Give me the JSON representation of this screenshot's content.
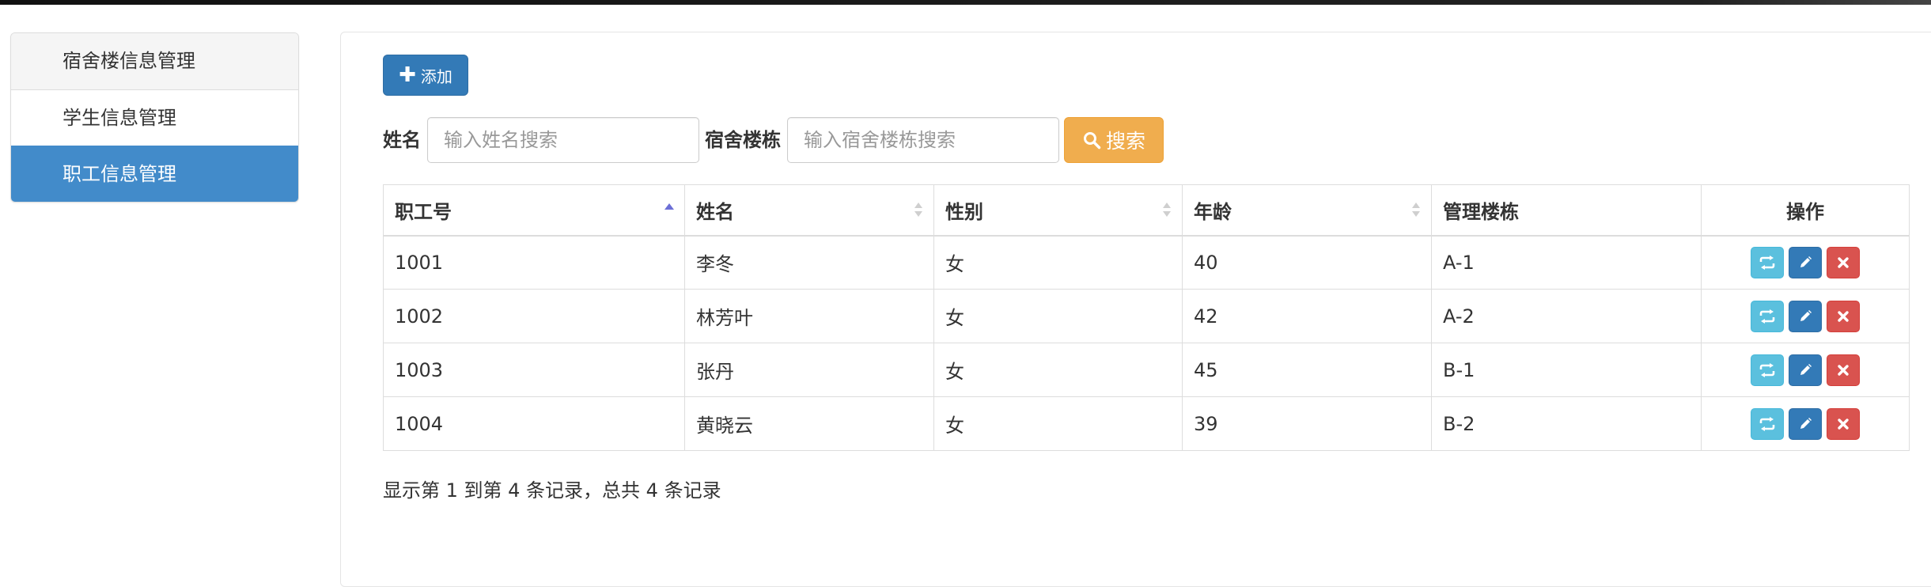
{
  "sidebar": {
    "items": [
      {
        "label": "宿舍楼信息管理"
      },
      {
        "label": "学生信息管理"
      },
      {
        "label": "职工信息管理"
      }
    ]
  },
  "toolbar": {
    "add_label": "添加",
    "add_icon": "plus-icon"
  },
  "search": {
    "name_label": "姓名",
    "name_placeholder": "输入姓名搜索",
    "name_value": "",
    "building_label": "宿舍楼栋",
    "building_placeholder": "输入宿舍楼栋搜索",
    "building_value": "",
    "button_label": "搜索",
    "button_icon": "search-icon"
  },
  "table": {
    "columns": [
      {
        "label": "职工号"
      },
      {
        "label": "姓名"
      },
      {
        "label": "性别"
      },
      {
        "label": "年龄"
      },
      {
        "label": "管理楼栋"
      },
      {
        "label": "操作"
      }
    ],
    "rows": [
      {
        "id": "1001",
        "name": "李冬",
        "gender": "女",
        "age": "40",
        "building": "A-1"
      },
      {
        "id": "1002",
        "name": "林芳叶",
        "gender": "女",
        "age": "42",
        "building": "A-2"
      },
      {
        "id": "1003",
        "name": "张丹",
        "gender": "女",
        "age": "45",
        "building": "B-1"
      },
      {
        "id": "1004",
        "name": "黄晓云",
        "gender": "女",
        "age": "39",
        "building": "B-2"
      }
    ],
    "row_actions": [
      "refresh-icon",
      "pencil-icon",
      "close-icon"
    ]
  },
  "pagination": {
    "info": "显示第 1 到第 4 条记录，总共 4 条记录"
  },
  "colors": {
    "primary": "#337ab7",
    "active_nav": "#428bca",
    "warning": "#f0ad4e",
    "info": "#5bc0de",
    "danger": "#d9534f"
  }
}
